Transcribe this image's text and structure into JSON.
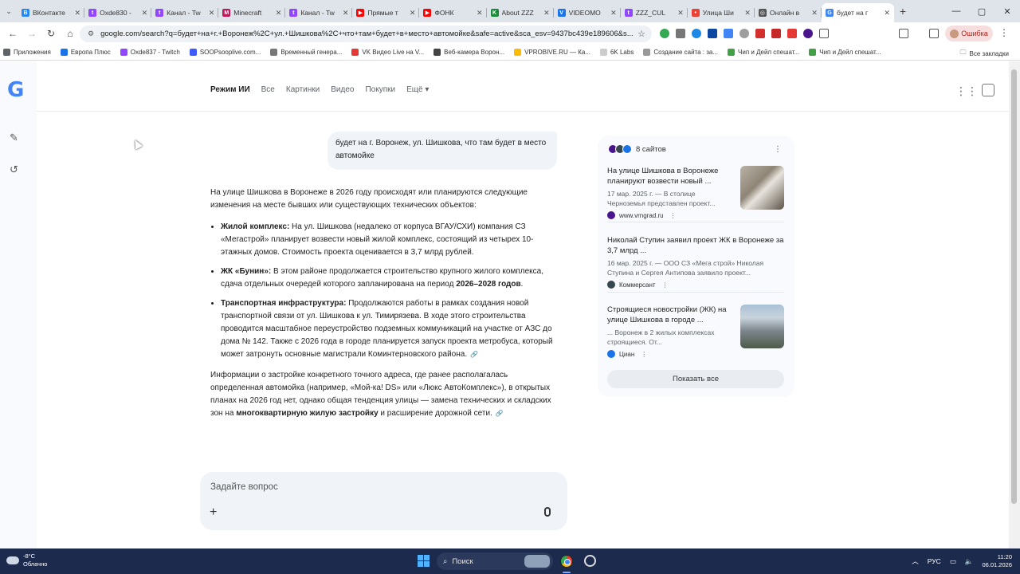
{
  "tabs": [
    {
      "label": "ВКонтакте",
      "color": "#2787f5",
      "glyph": "B"
    },
    {
      "label": "Oxde830 -",
      "color": "#9146ff",
      "glyph": "t"
    },
    {
      "label": "Канал - Tw",
      "color": "#9146ff",
      "glyph": "t"
    },
    {
      "label": "Minecraft",
      "color": "#c2185b",
      "glyph": "M"
    },
    {
      "label": "Канал - Tw",
      "color": "#9146ff",
      "glyph": "t"
    },
    {
      "label": "Прямые т",
      "color": "#ff0000",
      "glyph": "▶"
    },
    {
      "label": "ФОНК",
      "color": "#ff0000",
      "glyph": "▶"
    },
    {
      "label": "About ZZZ",
      "color": "#1b8a3a",
      "glyph": "K"
    },
    {
      "label": "VIDEOMO",
      "color": "#1a73e8",
      "glyph": "V"
    },
    {
      "label": "ZZZ_CUL",
      "color": "#9146ff",
      "glyph": "t"
    },
    {
      "label": "Улица Ши",
      "color": "#ea4335",
      "glyph": "•"
    },
    {
      "label": "Онлайн в",
      "color": "#555555",
      "glyph": "◎"
    }
  ],
  "active_tab": {
    "label": "будет на г",
    "color": "#4285f4",
    "glyph": "G"
  },
  "address": {
    "url": "google.com/search?q=будет+на+г.+Воронеж%2C+ул.+Шишкова%2C+что+там+будет+в+место+автомойке&safe=active&sca_esv=9437bc439e189606&s..."
  },
  "error_chip": "Ошибка",
  "bookmarks": [
    {
      "label": "Приложения",
      "color": "#5f6368"
    },
    {
      "label": "Европа Плюс",
      "color": "#1a73e8"
    },
    {
      "label": "Oxde837 - Twitch",
      "color": "#9146ff"
    },
    {
      "label": "SOOPsooplive.com...",
      "color": "#3d5afe"
    },
    {
      "label": "Временный генера...",
      "color": "#777777"
    },
    {
      "label": "VK Видео Live на V...",
      "color": "#e53935"
    },
    {
      "label": "Веб-камера Ворон...",
      "color": "#444444"
    },
    {
      "label": "VPROBIVE.RU — Ка...",
      "color": "#fbbc04"
    },
    {
      "label": "6K Labs",
      "color": "#cccccc"
    },
    {
      "label": "Создание сайта : за...",
      "color": "#999999"
    },
    {
      "label": "Чип и Дейл спешат...",
      "color": "#43a047"
    },
    {
      "label": "Чип и Дейл спешат...",
      "color": "#43a047"
    }
  ],
  "bookmarks_all": "Все закладки",
  "modes": [
    "Режим ИИ",
    "Все",
    "Картинки",
    "Видео",
    "Покупки",
    "Ещё ▾"
  ],
  "query": "будет на г. Воронеж, ул. Шишкова, что там будет в место автомойке",
  "answer": {
    "intro": "На улице Шишкова в Воронеже в 2026 году происходят или планируются следующие изменения на месте бывших или существующих технических объектов:",
    "items": [
      {
        "head": "Жилой комплекс:",
        "body": " На ул. Шишкова (недалеко от корпуса ВГАУ/СХИ) компания СЗ «Мегастрой» планирует возвести новый жилой комплекс, состоящий из четырех 10-этажных домов. Стоимость проекта оценивается в 3,7 млрд рублей."
      },
      {
        "head": "ЖК «Бунин»:",
        "body": " В этом районе продолжается строительство крупного жилого комплекса, сдача отдельных очередей которого запланирована на период ",
        "bold_tail": "2026–2028 годов",
        "tail": "."
      },
      {
        "head": "Транспортная инфраструктура:",
        "body": " Продолжаются работы в рамках создания новой транспортной связи от ул. Шишкова к ул. Тимирязева. В ходе этого строительства проводится масштабное переустройство подземных коммуникаций на участке от АЗС до дома № 142. Также с 2026 года в городе планируется запуск проекта метробуса, который может затронуть основные магистрали Коминтерновского района."
      }
    ],
    "outro_a": "Информации о застройке конкретного точного адреса, где ранее располагалась определенная автомойка (например, «Мой-ка! DS» или «Люкс АвтоКомплекс»), в открытых планах на 2026 год нет, однако общая тенденция улицы — замена технических и складских зон на ",
    "outro_bold": "многоквартирную жилую застройку",
    "outro_b": " и расширение дорожной сети."
  },
  "ask_placeholder": "Задайте вопрос",
  "sources": {
    "count_label": "8 сайтов",
    "cards": [
      {
        "title": "На улице Шишкова в Воронеже планируют возвести новый ...",
        "desc": "17 мар. 2025 г. — В столице Черноземья представлен проект...",
        "site": "www.vrngrad.ru",
        "site_color": "#4a148c",
        "thumb": "cat"
      },
      {
        "title": "Николай Ступин заявил проект ЖК в Воронеже за 3,7 млрд ...",
        "desc": "16 мар. 2025 г. — ООО СЗ «Мега строй» Николая Ступина и Сергея Антипова заявило проект...",
        "site": "Коммерсант",
        "site_color": "#37474f",
        "thumb": ""
      },
      {
        "title": "Строящиеся новостройки (ЖК) на улице Шишкова в городе ...",
        "desc": "... Воронеж в 2 жилых комплексах строящиеся. От...",
        "site": "Циан",
        "site_color": "#1a73e8",
        "thumb": "building"
      }
    ],
    "show_all": "Показать все"
  },
  "taskbar": {
    "temp": "-8°C",
    "weather": "Облачно",
    "search": "Поиск",
    "lang": "РУС",
    "time": "11:20",
    "date": "06.01.2026"
  }
}
